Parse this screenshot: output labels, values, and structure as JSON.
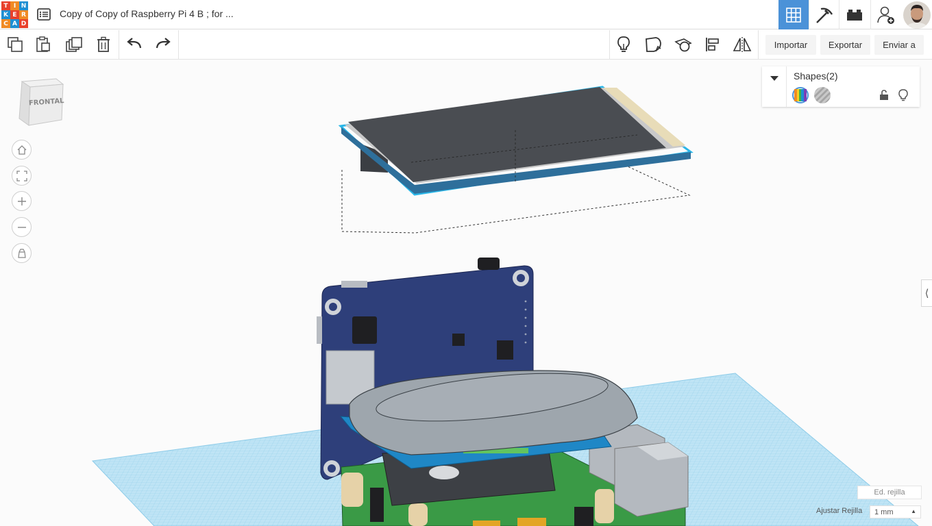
{
  "app": {
    "logo_letters": [
      "T",
      "I",
      "N",
      "K",
      "E",
      "R",
      "C",
      "A",
      "D"
    ],
    "design_title": "Copy of Copy of Raspberry Pi 4 B ; for ...",
    "menu_icon": "design-list-icon",
    "view_buttons": [
      {
        "name": "3d-design",
        "icon": "grid-icon",
        "active": true
      },
      {
        "name": "codeblocks",
        "icon": "pickaxe-icon",
        "active": false
      },
      {
        "name": "bricks",
        "icon": "bricks-icon",
        "active": false
      },
      {
        "name": "invite-user",
        "icon": "add-user-icon",
        "active": false
      }
    ],
    "accent": "#4b92d8"
  },
  "toolbar": {
    "left_tools": [
      "copy-icon",
      "paste-icon",
      "duplicate-icon",
      "trash-icon",
      "undo-icon",
      "redo-icon"
    ],
    "right_tools": [
      "lightbulb-icon",
      "note-icon",
      "workplane-icon",
      "align-icon",
      "mirror-icon"
    ],
    "import_label": "Importar",
    "export_label": "Exportar",
    "send_label": "Enviar a"
  },
  "viewcube": {
    "face_label": "FRONTAL"
  },
  "nav": [
    "home-icon",
    "fit-view-icon",
    "zoom-in-icon",
    "zoom-out-icon",
    "perspective-icon"
  ],
  "shapes_panel": {
    "title": "Shapes(2)",
    "controls": [
      "solid-color-icon",
      "hole-icon",
      "unlock-icon",
      "lightbulb-icon"
    ]
  },
  "grid_controls": {
    "edit_grid_label": "Ed. rejilla",
    "snap_label": "Ajustar Rejilla",
    "snap_value": "1 mm"
  },
  "colors": {
    "workplane_fill": "#bfe4f5",
    "workplane_line": "#8ccbe8",
    "selection_outline": "#29b6e8",
    "pcb_blue": "#2e3f7a",
    "pcb_green": "#3a9a46",
    "case_gray": "#9ea6ad",
    "screen_dark": "#4a4d52"
  }
}
